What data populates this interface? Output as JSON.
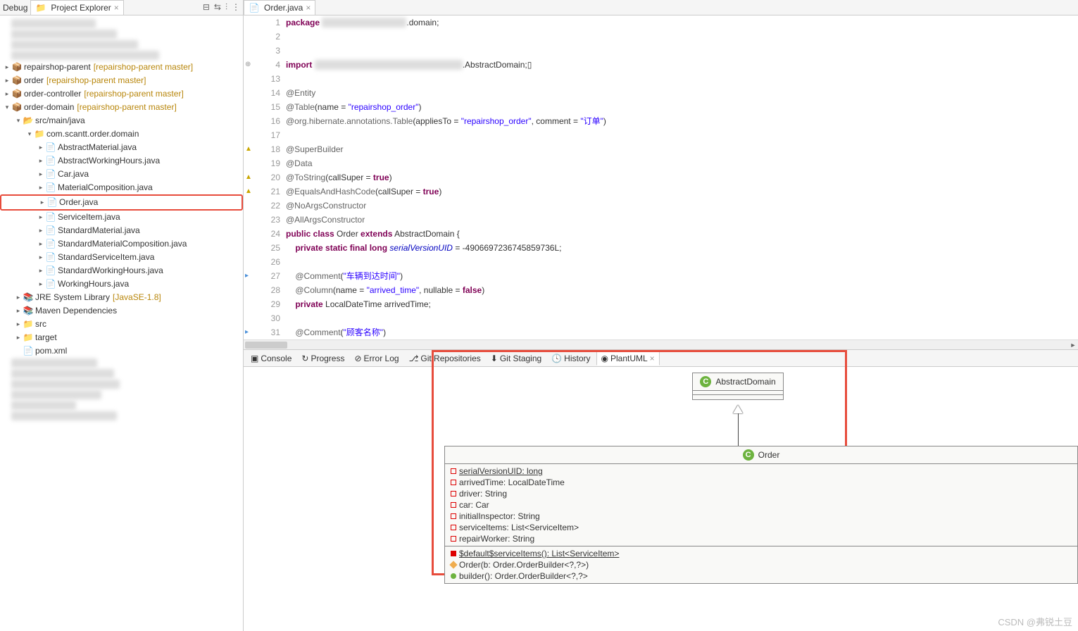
{
  "sidebar": {
    "debug_label": "Debug",
    "explorer_tab": "Project Explorer",
    "tree": [
      {
        "indent": 0,
        "arrow": ">",
        "icon": "project",
        "label": "repairshop-parent",
        "suffix": "[repairshop-parent master]"
      },
      {
        "indent": 0,
        "arrow": ">",
        "icon": "project",
        "label": "order",
        "suffix": "[repairshop-parent master]"
      },
      {
        "indent": 0,
        "arrow": ">",
        "icon": "project",
        "label": "order-controller",
        "suffix": "[repairshop-parent master]"
      },
      {
        "indent": 0,
        "arrow": "v",
        "icon": "project",
        "label": "order-domain",
        "suffix": "[repairshop-parent master]"
      },
      {
        "indent": 1,
        "arrow": "v",
        "icon": "pkg-folder",
        "label": "src/main/java",
        "suffix": ""
      },
      {
        "indent": 2,
        "arrow": "v",
        "icon": "package",
        "label": "com.scantt.order.domain",
        "suffix": ""
      },
      {
        "indent": 3,
        "arrow": ">",
        "icon": "java",
        "label": "AbstractMaterial.java",
        "suffix": ""
      },
      {
        "indent": 3,
        "arrow": ">",
        "icon": "java",
        "label": "AbstractWorkingHours.java",
        "suffix": ""
      },
      {
        "indent": 3,
        "arrow": ">",
        "icon": "java",
        "label": "Car.java",
        "suffix": ""
      },
      {
        "indent": 3,
        "arrow": ">",
        "icon": "java",
        "label": "MaterialComposition.java",
        "suffix": ""
      },
      {
        "indent": 3,
        "arrow": ">",
        "icon": "java",
        "label": "Order.java",
        "suffix": "",
        "highlighted": true
      },
      {
        "indent": 3,
        "arrow": ">",
        "icon": "java",
        "label": "ServiceItem.java",
        "suffix": ""
      },
      {
        "indent": 3,
        "arrow": ">",
        "icon": "java",
        "label": "StandardMaterial.java",
        "suffix": ""
      },
      {
        "indent": 3,
        "arrow": ">",
        "icon": "java",
        "label": "StandardMaterialComposition.java",
        "suffix": ""
      },
      {
        "indent": 3,
        "arrow": ">",
        "icon": "java",
        "label": "StandardServiceItem.java",
        "suffix": ""
      },
      {
        "indent": 3,
        "arrow": ">",
        "icon": "java",
        "label": "StandardWorkingHours.java",
        "suffix": ""
      },
      {
        "indent": 3,
        "arrow": ">",
        "icon": "java",
        "label": "WorkingHours.java",
        "suffix": ""
      },
      {
        "indent": 1,
        "arrow": ">",
        "icon": "library",
        "label": "JRE System Library",
        "suffix": "[JavaSE-1.8]"
      },
      {
        "indent": 1,
        "arrow": ">",
        "icon": "library",
        "label": "Maven Dependencies",
        "suffix": ""
      },
      {
        "indent": 1,
        "arrow": ">",
        "icon": "folder",
        "label": "src",
        "suffix": ""
      },
      {
        "indent": 1,
        "arrow": ">",
        "icon": "folder",
        "label": "target",
        "suffix": ""
      },
      {
        "indent": 1,
        "arrow": "",
        "icon": "xml",
        "label": "pom.xml",
        "suffix": ""
      }
    ]
  },
  "editor": {
    "tab_name": "Order.java",
    "lines": [
      {
        "n": 1,
        "marker": "",
        "html": "<span class='kw'>package</span> <span class='blur'>xxxxxxxxxxxxxxxxxxxx</span>.domain;"
      },
      {
        "n": 2,
        "marker": "",
        "html": ""
      },
      {
        "n": 3,
        "marker": "",
        "html": ""
      },
      {
        "n": 4,
        "marker": "fold",
        "html": "<span class='kw'>import</span> <span class='blur'>xxxxxxxxxxxxxxxxxxxxxxxxxxxxxxxxxxx</span>.AbstractDomain;▯"
      },
      {
        "n": 13,
        "marker": "",
        "html": ""
      },
      {
        "n": 14,
        "marker": "",
        "html": "<span class='ann'>@Entity</span>"
      },
      {
        "n": 15,
        "marker": "",
        "html": "<span class='ann'>@Table</span>(name = <span class='str'>\"repairshop_order\"</span>)"
      },
      {
        "n": 16,
        "marker": "",
        "html": "<span class='ann'>@org.hibernate.annotations.Table</span>(appliesTo = <span class='str'>\"repairshop_order\"</span>, comment = <span class='str'>\"订单\"</span>)"
      },
      {
        "n": 17,
        "marker": "",
        "html": ""
      },
      {
        "n": 18,
        "marker": "warn",
        "html": "<span class='ann'>@SuperBuilder</span>"
      },
      {
        "n": 19,
        "marker": "",
        "html": "<span class='ann'>@Data</span>"
      },
      {
        "n": 20,
        "marker": "warn",
        "html": "<span class='ann'>@ToString</span>(callSuper = <span class='kw'>true</span>)"
      },
      {
        "n": 21,
        "marker": "warn",
        "html": "<span class='ann'>@EqualsAndHashCode</span>(callSuper = <span class='kw'>true</span>)"
      },
      {
        "n": 22,
        "marker": "",
        "html": "<span class='ann'>@NoArgsConstructor</span>"
      },
      {
        "n": 23,
        "marker": "",
        "html": "<span class='ann'>@AllArgsConstructor</span>"
      },
      {
        "n": 24,
        "marker": "",
        "html": "<span class='kw'>public class</span> Order <span class='kw'>extends</span> AbstractDomain {"
      },
      {
        "n": 25,
        "marker": "",
        "html": "    <span class='kw'>private static final long</span> <span class='ident'>serialVersionUID</span> = -4906697236745859736L;"
      },
      {
        "n": 26,
        "marker": "",
        "html": ""
      },
      {
        "n": 27,
        "marker": "change",
        "html": "    <span class='ann'>@Comment</span>(<span class='str'>\"车辆到达时间\"</span>)"
      },
      {
        "n": 28,
        "marker": "",
        "html": "    <span class='ann'>@Column</span>(name = <span class='str'>\"arrived_time\"</span>, nullable = <span class='kw'>false</span>)"
      },
      {
        "n": 29,
        "marker": "",
        "html": "    <span class='kw'>private</span> LocalDateTime arrivedTime;"
      },
      {
        "n": 30,
        "marker": "",
        "html": ""
      },
      {
        "n": 31,
        "marker": "change",
        "html": "    <span class='ann'>@Comment</span>(<span class='str'>\"顾客名称\"</span>)"
      }
    ]
  },
  "bottom": {
    "tabs": [
      "Console",
      "Progress",
      "Error Log",
      "Git Repositories",
      "Git Staging",
      "History",
      "PlantUML"
    ],
    "active_tab": "PlantUML"
  },
  "uml": {
    "parent_class": "AbstractDomain",
    "child_class": "Order",
    "fields": [
      {
        "vis": "sq red",
        "text": "serialVersionUID: long",
        "underlined": true
      },
      {
        "vis": "sq red",
        "text": "arrivedTime: LocalDateTime"
      },
      {
        "vis": "sq red",
        "text": "driver: String"
      },
      {
        "vis": "sq red",
        "text": "car: Car"
      },
      {
        "vis": "sq red",
        "text": "initialInspector: String"
      },
      {
        "vis": "sq red",
        "text": "serviceItems: List<ServiceItem>"
      },
      {
        "vis": "sq red",
        "text": "repairWorker: String"
      }
    ],
    "methods": [
      {
        "vis": "sq red-fill",
        "text": "$default$serviceItems(): List<ServiceItem>",
        "underlined": true
      },
      {
        "vis": "diamond",
        "text": "Order(b: Order.OrderBuilder<?,?>)"
      },
      {
        "vis": "circle",
        "text": "builder(): Order.OrderBuilder<?,?>"
      }
    ]
  },
  "watermark": "CSDN @弗锐土豆"
}
